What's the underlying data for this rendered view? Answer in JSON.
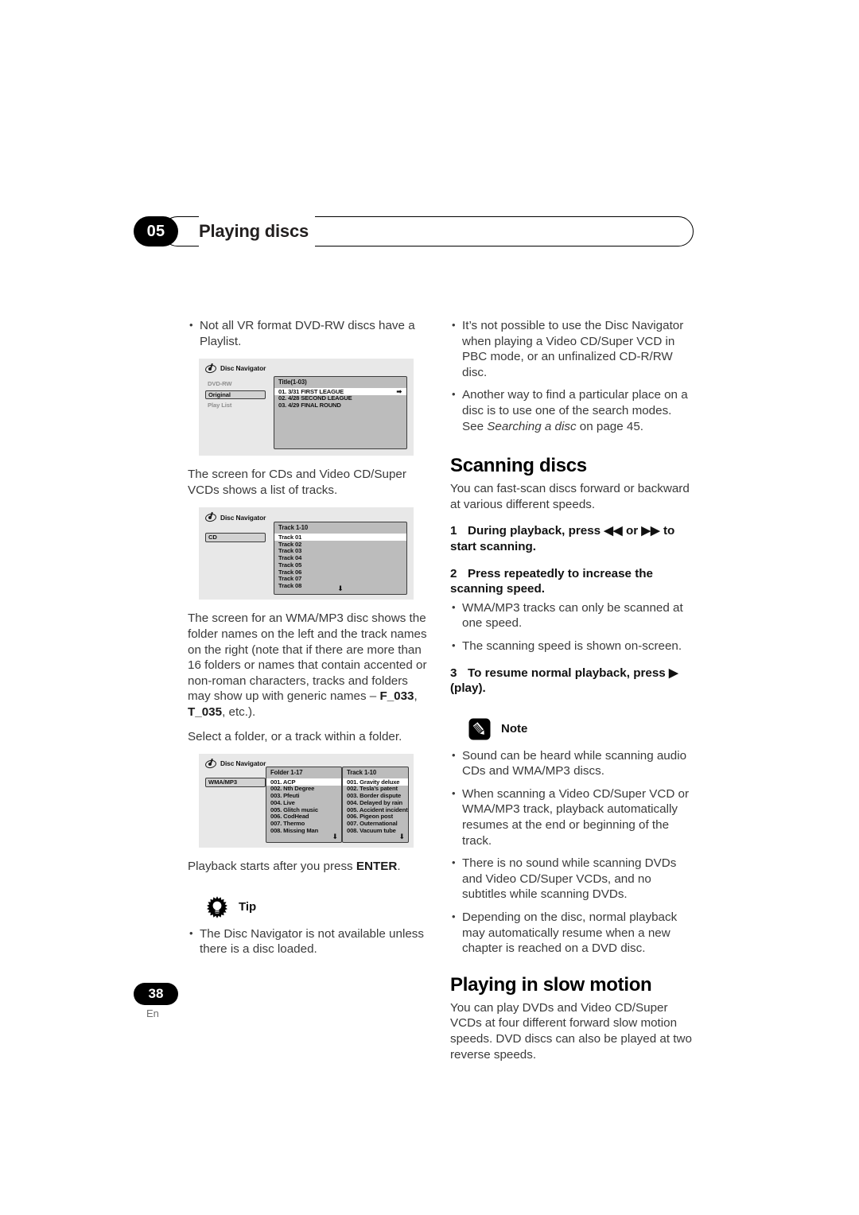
{
  "header": {
    "chapter_number": "05",
    "title": "Playing discs"
  },
  "footer": {
    "page_number": "38",
    "language": "En"
  },
  "left_column": {
    "bullet_playlist": "Not all VR format DVD-RW discs have a Playlist.",
    "para_cd_screen": "The screen for CDs and Video CD/Super VCDs shows a list of tracks.",
    "para_wma_1": "The screen for an WMA/MP3 disc shows the folder names on the left and the track names on the right (note that if there are more than 16 folders or names that contain accented or non-roman characters, tracks and folders may show up with generic names – ",
    "para_wma_bold1": "F_033",
    "para_wma_mid": ", ",
    "para_wma_bold2": "T_035",
    "para_wma_end": ", etc.).",
    "para_select_folder": "Select a folder, or a track within a folder.",
    "para_playback_starts_1": "Playback starts after you press ",
    "para_playback_starts_bold": "ENTER",
    "para_playback_starts_2": ".",
    "tip_label": "Tip",
    "tip_bullet": "The Disc Navigator is not available unless there is a disc loaded."
  },
  "right_column": {
    "bullet_pbc": "It’s not possible to use the Disc Navigator when playing a Video CD/Super VCD in PBC mode, or an unfinalized CD-R/RW disc.",
    "bullet_search_1": "Another way to find a particular place on a disc is to use one of the search modes. See ",
    "bullet_search_italic": "Searching a disc",
    "bullet_search_2": " on page 45.",
    "scanning_heading": "Scanning discs",
    "scanning_intro": "You can fast-scan discs forward or backward at various different speeds.",
    "step1_num": "1",
    "step1_text_a": "During playback, press ",
    "step1_rev_icon": "◀◀",
    "step1_text_b": " or ",
    "step1_fwd_icon": "▶▶",
    "step1_text_c": " to start scanning.",
    "step2_num": "2",
    "step2_text": "Press repeatedly to increase the scanning speed.",
    "step2_bullets": [
      "WMA/MP3 tracks can only be scanned at one speed.",
      "The scanning speed is shown on-screen."
    ],
    "step3_num": "3",
    "step3_text_a": "To resume normal playback, press ",
    "step3_play_icon": "▶",
    "step3_text_b": " (play).",
    "note_label": "Note",
    "note_bullets": [
      "Sound can be heard while scanning audio CDs and WMA/MP3 discs.",
      "When scanning a Video CD/Super VCD or WMA/MP3 track, playback automatically resumes at the end or beginning of the track.",
      "There is no sound while scanning DVDs and Video CD/Super VCDs, and no subtitles while scanning DVDs.",
      "Depending on the disc, normal playback may automatically resume when a new chapter is reached on a DVD disc."
    ],
    "slow_motion_heading": "Playing in slow motion",
    "slow_motion_body": "You can play DVDs and Video CD/Super VCDs at four different forward slow motion speeds. DVD discs can also be played at two reverse speeds."
  },
  "figures": {
    "dvdrw": {
      "window_title": "Disc Navigator",
      "side_labels": [
        {
          "label": "DVD-RW",
          "selected": false
        },
        {
          "label": "Original",
          "selected": true
        },
        {
          "label": "Play List",
          "selected": false
        }
      ],
      "panel_header": "Title(1-03)",
      "rows": [
        {
          "label": "01. 3/31 FIRST LEAGUE",
          "selected": true,
          "arrow": "➡"
        },
        {
          "label": "02. 4/28 SECOND LEAGUE",
          "selected": false,
          "arrow": ""
        },
        {
          "label": "03. 4/29 FINAL ROUND",
          "selected": false,
          "arrow": ""
        }
      ]
    },
    "cd": {
      "window_title": "Disc Navigator",
      "side_labels": [
        {
          "label": "CD",
          "selected": true
        }
      ],
      "panel_header": "Track 1-10",
      "rows": [
        {
          "label": "Track 01",
          "selected": true
        },
        {
          "label": "Track 02",
          "selected": false
        },
        {
          "label": "Track 03",
          "selected": false
        },
        {
          "label": "Track 04",
          "selected": false
        },
        {
          "label": "Track 05",
          "selected": false
        },
        {
          "label": "Track 06",
          "selected": false
        },
        {
          "label": "Track 07",
          "selected": false
        },
        {
          "label": "Track 08",
          "selected": false
        }
      ],
      "scroll_indicator": "⬇"
    },
    "wma": {
      "window_title": "Disc Navigator",
      "side_labels": [
        {
          "label": "WMA/MP3",
          "selected": true
        }
      ],
      "folder_panel_header": "Folder 1-17",
      "folder_rows": [
        {
          "label": "001. ACP",
          "selected": true
        },
        {
          "label": "002. Nth Degree",
          "selected": false
        },
        {
          "label": "003. Pfeuti",
          "selected": false
        },
        {
          "label": "004. Live",
          "selected": false
        },
        {
          "label": "005. Glitch music",
          "selected": false
        },
        {
          "label": "006. CodHead",
          "selected": false
        },
        {
          "label": "007. Thermo",
          "selected": false
        },
        {
          "label": "008. Missing Man",
          "selected": false
        }
      ],
      "track_panel_header": "Track 1-10",
      "track_rows": [
        {
          "label": "001. Gravity deluxe",
          "selected": true
        },
        {
          "label": "002. Tesla’s patent",
          "selected": false
        },
        {
          "label": "003. Border dispute",
          "selected": false
        },
        {
          "label": "004. Delayed by rain",
          "selected": false
        },
        {
          "label": "005. Accident incident",
          "selected": false
        },
        {
          "label": "006. Pigeon post",
          "selected": false
        },
        {
          "label": "007. Outernational",
          "selected": false
        },
        {
          "label": "008. Vacuum tube",
          "selected": false
        }
      ],
      "scroll_indicator": "⬇"
    }
  }
}
